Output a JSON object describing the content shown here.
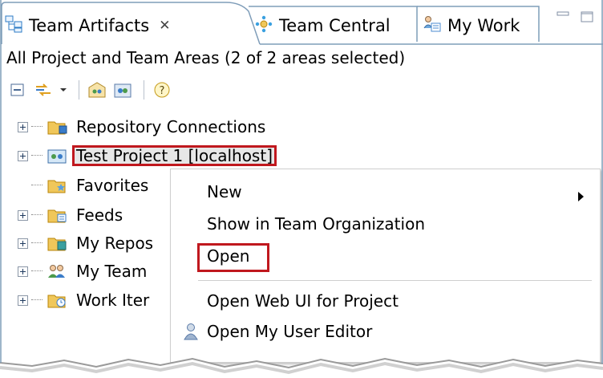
{
  "tabs": [
    {
      "label": "Team Artifacts",
      "close_icon": "close-x-icon",
      "icon": "team-artifacts-icon",
      "active": true
    },
    {
      "label": "Team Central",
      "icon": "team-central-icon",
      "active": false
    },
    {
      "label": "My Work",
      "icon": "my-work-icon",
      "active": false
    }
  ],
  "view": {
    "title": "All Project and Team Areas (2 of 2 areas selected)"
  },
  "toolbar": {
    "buttons": [
      "collapse-all-icon",
      "sync-icon",
      "dropdown-arrow-icon",
      "project-area-icon",
      "team-area-icon",
      "help-icon"
    ]
  },
  "tree": {
    "items": [
      {
        "label": "Repository Connections",
        "icon": "repository-connections-icon",
        "expandable": true
      },
      {
        "label": "Test Project 1 [localhost]",
        "icon": "project-area-icon",
        "expandable": true,
        "highlighted": true
      },
      {
        "label": "Favorites",
        "icon": "favorites-icon",
        "expandable": false
      },
      {
        "label": "Feeds",
        "icon": "feeds-icon",
        "expandable": true
      },
      {
        "label": "My Repos",
        "icon": "my-repositories-icon",
        "expandable": true
      },
      {
        "label": "My Team",
        "icon": "my-teams-icon",
        "expandable": true
      },
      {
        "label": "Work Iter",
        "icon": "work-items-icon",
        "expandable": true
      }
    ]
  },
  "context_menu": {
    "items": [
      {
        "label": "New",
        "has_submenu": true
      },
      {
        "label": "Show in Team Organization",
        "has_submenu": false
      },
      {
        "label": "Open",
        "has_submenu": false,
        "highlighted": true
      },
      {
        "label": "Open Web UI for Project",
        "has_submenu": false
      },
      {
        "label": "Open My User Editor",
        "has_submenu": false,
        "icon": "user-icon"
      }
    ]
  },
  "colors": {
    "highlight_border": "#c0181e",
    "selection_bg": "#e7e7e7",
    "tab_border": "#7f9db9",
    "folder": "#f0c75a"
  }
}
